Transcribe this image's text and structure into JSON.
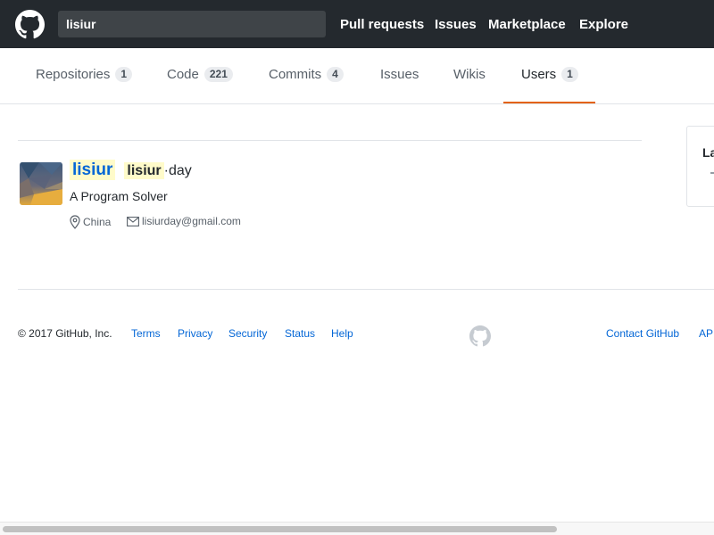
{
  "header": {
    "search_value": "lisiur",
    "nav": [
      "Pull requests",
      "Issues",
      "Marketplace",
      "Explore"
    ]
  },
  "tabs": [
    {
      "label": "Repositories",
      "count": "1"
    },
    {
      "label": "Code",
      "count": "221"
    },
    {
      "label": "Commits",
      "count": "4"
    },
    {
      "label": "Issues",
      "count": ""
    },
    {
      "label": "Wikis",
      "count": ""
    },
    {
      "label": "Users",
      "count": "1",
      "selected": true
    }
  ],
  "accent_color": "#e36209",
  "side_box": {
    "label": "La"
  },
  "result": {
    "login": "lisiur",
    "fullname_match": "lisiur",
    "fullname_rest": "·day",
    "bio": "A Program Solver",
    "location": "China",
    "email": "lisiurday@gmail.com"
  },
  "footer": {
    "copyright": "© 2017 GitHub, Inc.",
    "links_left": [
      "Terms",
      "Privacy",
      "Security",
      "Status",
      "Help"
    ],
    "links_right": [
      "Contact GitHub",
      "API"
    ]
  },
  "icons": [
    "github-mark-icon",
    "location-icon",
    "mail-icon"
  ]
}
